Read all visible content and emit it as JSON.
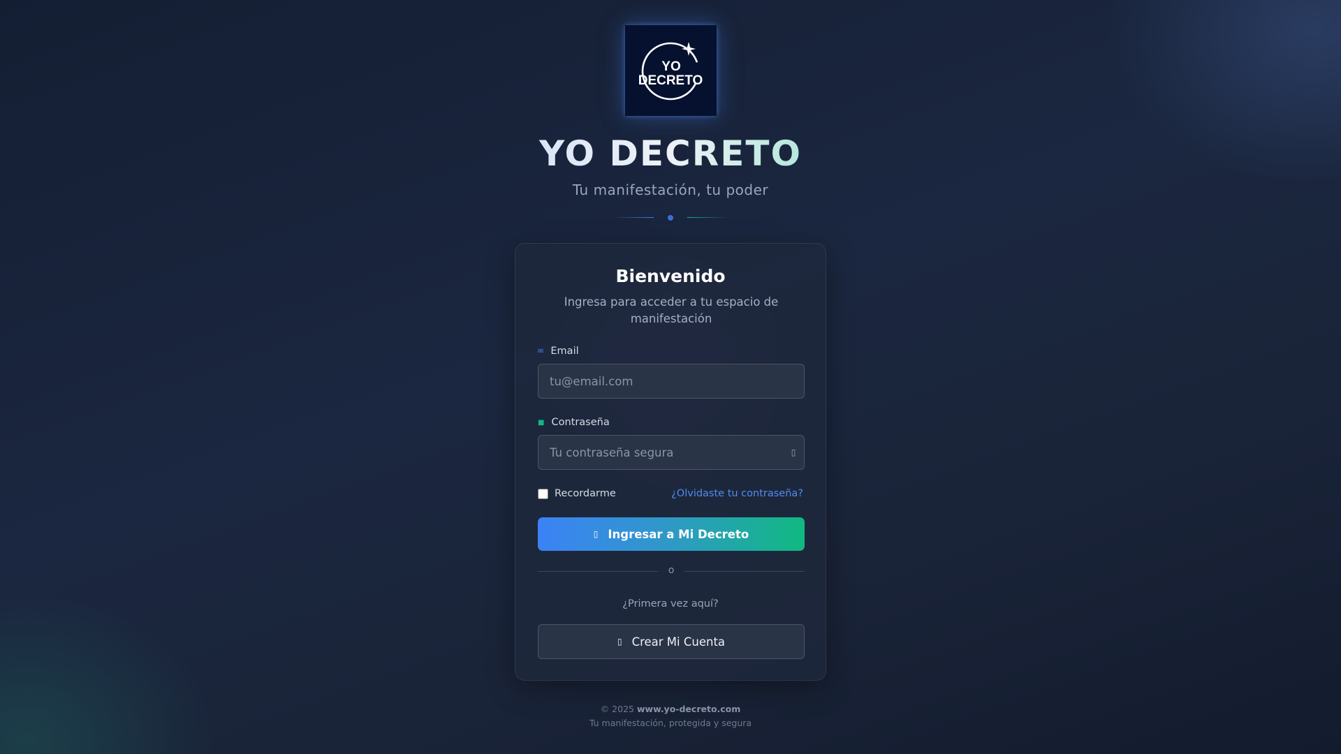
{
  "logo": {
    "line1": "YO",
    "line2": "DECRETO",
    "icon": "sparkle-icon"
  },
  "brand": {
    "title": "YO DECRETO",
    "subtitle": "Tu manifestación, tu poder"
  },
  "card": {
    "title": "Bienvenido",
    "description": "Ingresa para acceder a tu espacio de manifestación",
    "email": {
      "label": "Email",
      "placeholder": "tu@email.com",
      "value": "",
      "icon": "envelope-icon"
    },
    "password": {
      "label": "Contraseña",
      "placeholder": "Tu contraseña segura",
      "value": "",
      "icon": "lock-icon",
      "toggle_icon": "eye-icon"
    },
    "remember": {
      "label": "Recordarme",
      "checked": false
    },
    "forgot_link": "¿Olvidaste tu contraseña?",
    "login_button": "Ingresar a Mi Decreto",
    "login_icon": "login-icon",
    "or_text": "o",
    "first_time": "¿Primera vez aquí?",
    "register_button": "Crear Mi Cuenta",
    "register_icon": "user-plus-icon"
  },
  "footer": {
    "copyright": "© 2025",
    "site": "www.yo-decreto.com",
    "tagline": "Tu manifestación, protegida y segura"
  },
  "colors": {
    "accent_blue": "#3b82f6",
    "accent_green": "#10b981",
    "background": "#1b2740"
  }
}
